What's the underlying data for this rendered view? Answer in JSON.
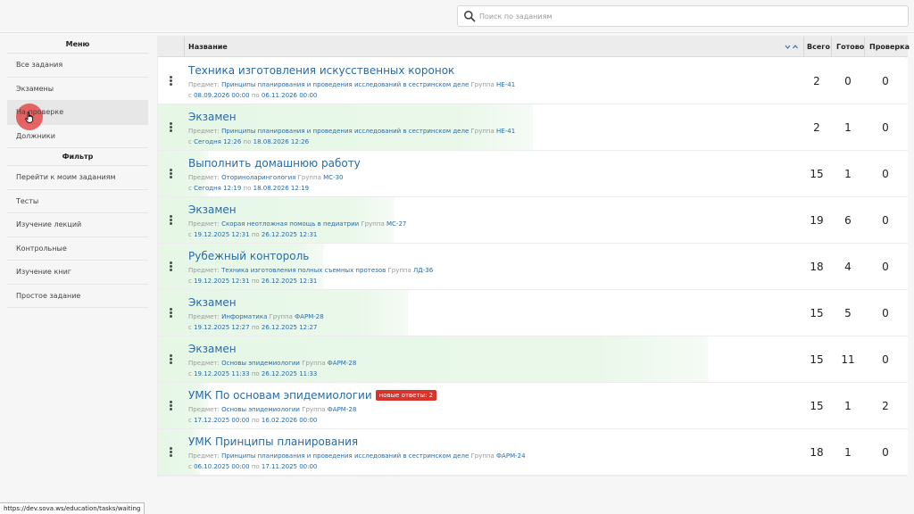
{
  "search": {
    "placeholder": "Поиск по заданиям",
    "value": ""
  },
  "sidebar": {
    "menu_title": "Меню",
    "menu": [
      {
        "label": "Все задания"
      },
      {
        "label": "Экзамены"
      },
      {
        "label": "На проверке",
        "active": true
      },
      {
        "label": "Должники"
      }
    ],
    "filter_title": "Фильтр",
    "filters": [
      {
        "label": "Перейти к моим заданиям"
      },
      {
        "label": "Тесты"
      },
      {
        "label": "Изучение лекций"
      },
      {
        "label": "Контрольные"
      },
      {
        "label": "Изучение книг"
      },
      {
        "label": "Простое задание"
      }
    ]
  },
  "table": {
    "headers": {
      "name": "Название",
      "total": "Всего",
      "done": "Готово",
      "check": "Проверка"
    },
    "labels": {
      "subject": "Предмет:",
      "group": "Группа",
      "from": "с",
      "to": "по"
    },
    "rows": [
      {
        "title": "Техника изготовления искусственных коронок",
        "badge": "",
        "subject": "Принципы планирования и проведения исследований в сестринском деле",
        "group": "НЕ-41",
        "start": "08.09.2026 00:00",
        "end": "06.11.2026 00:00",
        "total": "2",
        "done": "0",
        "check": "0",
        "progress": 0.0
      },
      {
        "title": "Экзамен",
        "badge": "",
        "subject": "Принципы планирования и проведения исследований в сестринском деле",
        "group": "НЕ-41",
        "start": "Сегодня 12:26",
        "end": "18.08.2026 12:26",
        "total": "2",
        "done": "1",
        "check": "0",
        "progress": 0.5
      },
      {
        "title": "Выполнить домашнюю работу",
        "badge": "",
        "subject": "Оториноларингология",
        "group": "МС-30",
        "start": "Сегодня 12:19",
        "end": "18.08.2026 12:19",
        "total": "15",
        "done": "1",
        "check": "0",
        "progress": 0.067
      },
      {
        "title": "Экзамен",
        "badge": "",
        "subject": "Скорая неотложная помощь в педиатрии",
        "group": "МС-27",
        "start": "19.12.2025 12:31",
        "end": "26.12.2025 12:31",
        "total": "19",
        "done": "6",
        "check": "0",
        "progress": 0.316
      },
      {
        "title": "Рубежный контороль",
        "badge": "",
        "subject": "Техника изготовления полных съемных протезов",
        "group": "ЛД-36",
        "start": "19.12.2025 12:31",
        "end": "26.12.2025 12:31",
        "total": "18",
        "done": "4",
        "check": "0",
        "progress": 0.222
      },
      {
        "title": "Экзамен",
        "badge": "",
        "subject": "Информатика",
        "group": "ФАРМ-28",
        "start": "19.12.2025 12:27",
        "end": "26.12.2025 12:27",
        "total": "15",
        "done": "5",
        "check": "0",
        "progress": 0.333
      },
      {
        "title": "Экзамен",
        "badge": "",
        "subject": "Основы эпидемиологии",
        "group": "ФАРМ-28",
        "start": "19.12.2025 11:33",
        "end": "26.12.2025 11:33",
        "total": "15",
        "done": "11",
        "check": "0",
        "progress": 0.733
      },
      {
        "title": "УМК По основам эпидемиологии",
        "badge": "новые ответы: 2",
        "subject": "Основы эпидемиологии",
        "group": "ФАРМ-28",
        "start": "17.12.2025 00:00",
        "end": "16.02.2026 00:00",
        "total": "15",
        "done": "1",
        "check": "2",
        "progress": 0.067
      },
      {
        "title": "УМК Принципы планирования",
        "badge": "",
        "subject": "Принципы планирования и проведения исследований в сестринском деле",
        "group": "ФАРМ-24",
        "start": "06.10.2025 00:00",
        "end": "17.11.2025 00:00",
        "total": "18",
        "done": "1",
        "check": "0",
        "progress": 0.056
      }
    ]
  },
  "status_url": "https://dev.sova.ws/education/tasks/waiting",
  "colors": {
    "link": "#2c6aa3",
    "badge": "#d9342b",
    "progress": "#e6f7e6",
    "click_marker": "#e24646"
  }
}
